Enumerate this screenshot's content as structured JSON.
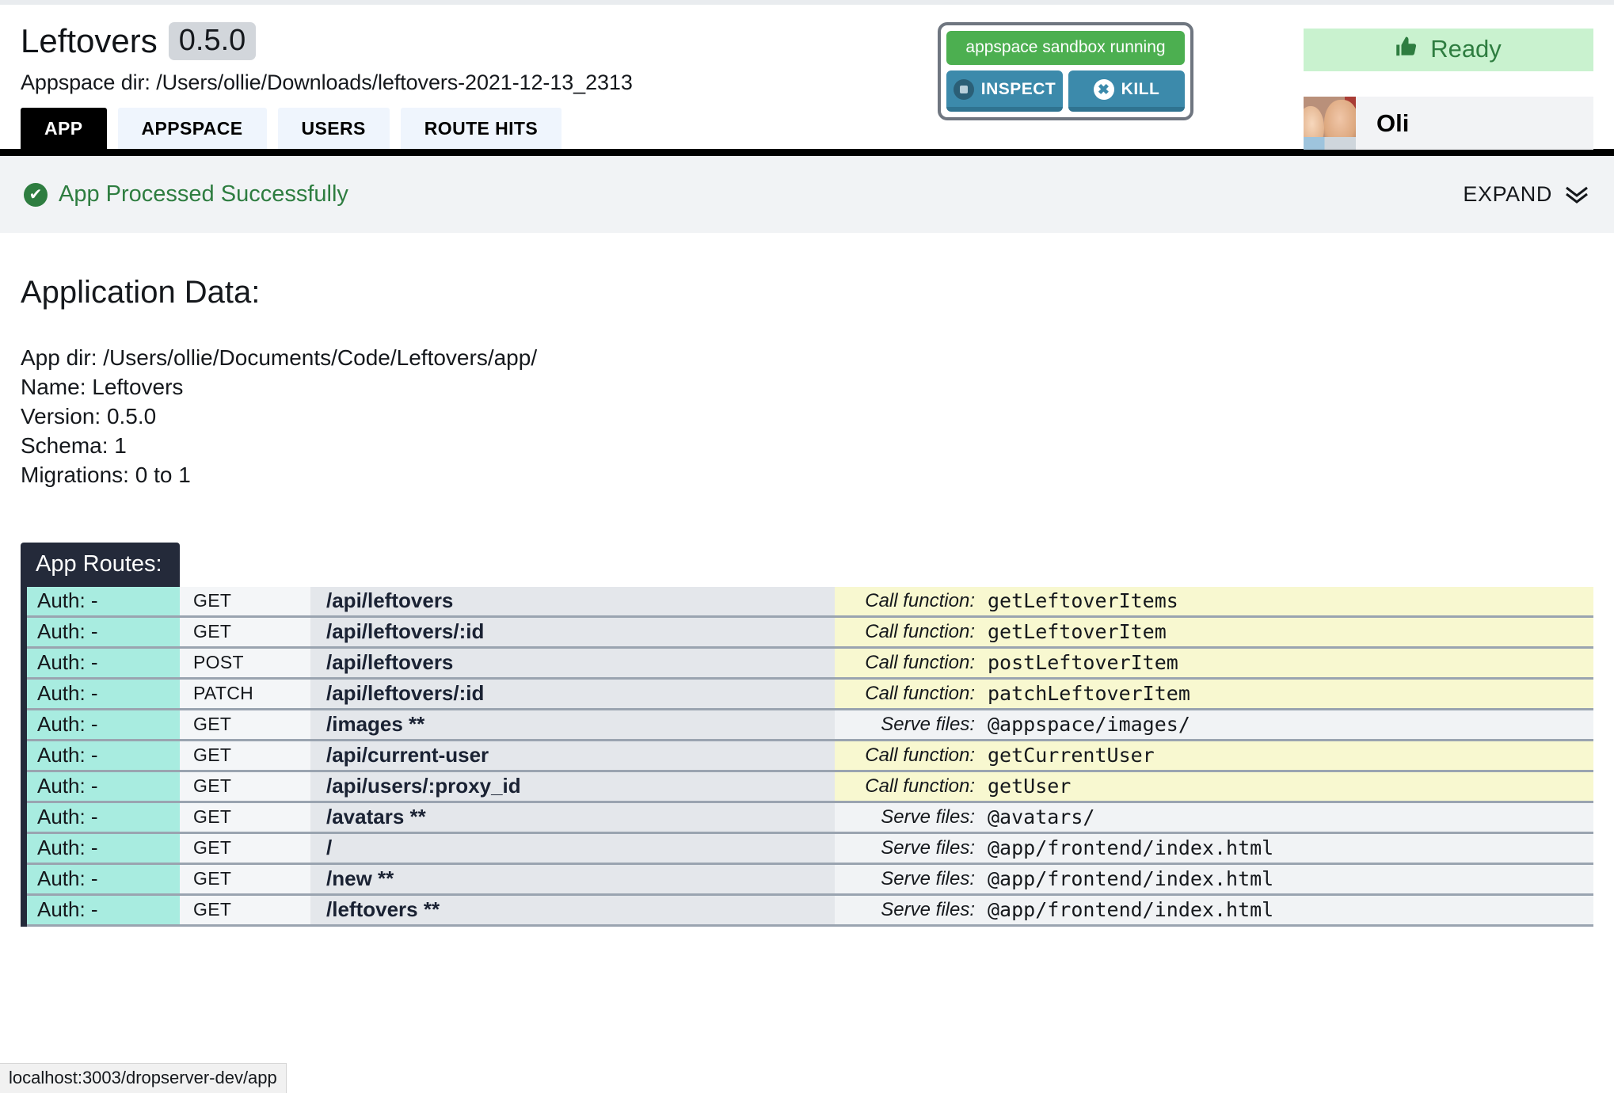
{
  "header": {
    "app_title": "Leftovers",
    "version_badge": "0.5.0",
    "appspace_dir": "Appspace dir: /Users/ollie/Downloads/leftovers-2021-12-13_2313",
    "tabs": [
      {
        "label": "APP",
        "active": true
      },
      {
        "label": "APPSPACE",
        "active": false
      },
      {
        "label": "USERS",
        "active": false
      },
      {
        "label": "ROUTE HITS",
        "active": false
      }
    ]
  },
  "sandbox": {
    "status_label": "appspace sandbox running",
    "inspect_label": "INSPECT",
    "kill_label": "KILL",
    "kill_glyph": "✖",
    "status_color": "#4caf50",
    "button_color": "#3c8aab"
  },
  "ready": {
    "label": "Ready",
    "thumb_glyph": "👍",
    "bg_color": "#c9f2cf",
    "fg_color": "#2e7d40"
  },
  "user": {
    "name": "Oli"
  },
  "statusbar": {
    "check_glyph": "✔",
    "message": "App Processed Successfully",
    "expand_label": "EXPAND",
    "message_color": "#2e7d40"
  },
  "main": {
    "section_title": "Application Data:",
    "meta": [
      "App dir: /Users/ollie/Documents/Code/Leftovers/app/",
      "Name: Leftovers",
      "Version: 0.5.0",
      "Schema: 1",
      "Migrations: 0 to 1"
    ],
    "routes_label": "App Routes:",
    "routes": [
      {
        "auth": "Auth: -",
        "method": "GET",
        "path": "/api/leftovers",
        "kind": "Call function:",
        "value": "getLeftoverItems",
        "type": "fn"
      },
      {
        "auth": "Auth: -",
        "method": "GET",
        "path": "/api/leftovers/:id",
        "kind": "Call function:",
        "value": "getLeftoverItem",
        "type": "fn"
      },
      {
        "auth": "Auth: -",
        "method": "POST",
        "path": "/api/leftovers",
        "kind": "Call function:",
        "value": "postLeftoverItem",
        "type": "fn"
      },
      {
        "auth": "Auth: -",
        "method": "PATCH",
        "path": "/api/leftovers/:id",
        "kind": "Call function:",
        "value": "patchLeftoverItem",
        "type": "fn"
      },
      {
        "auth": "Auth: -",
        "method": "GET",
        "path": "/images **",
        "kind": "Serve files:",
        "value": "@appspace/images/",
        "type": "files"
      },
      {
        "auth": "Auth: -",
        "method": "GET",
        "path": "/api/current-user",
        "kind": "Call function:",
        "value": "getCurrentUser",
        "type": "fn"
      },
      {
        "auth": "Auth: -",
        "method": "GET",
        "path": "/api/users/:proxy_id",
        "kind": "Call function:",
        "value": "getUser",
        "type": "fn"
      },
      {
        "auth": "Auth: -",
        "method": "GET",
        "path": "/avatars **",
        "kind": "Serve files:",
        "value": "@avatars/",
        "type": "files"
      },
      {
        "auth": "Auth: -",
        "method": "GET",
        "path": "/",
        "kind": "Serve files:",
        "value": "@app/frontend/index.html",
        "type": "files"
      },
      {
        "auth": "Auth: -",
        "method": "GET",
        "path": "/new **",
        "kind": "Serve files:",
        "value": "@app/frontend/index.html",
        "type": "files"
      },
      {
        "auth": "Auth: -",
        "method": "GET",
        "path": "/leftovers **",
        "kind": "Serve files:",
        "value": "@app/frontend/index.html",
        "type": "files"
      }
    ]
  },
  "browser": {
    "status_url": "localhost:3003/dropserver-dev/app"
  }
}
